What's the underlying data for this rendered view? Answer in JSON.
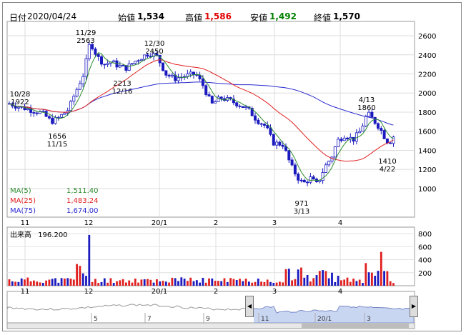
{
  "header": {
    "date_label": "日付",
    "date_value": "2020/04/24",
    "open_label": "始値",
    "open_value": "1,534",
    "high_label": "高値",
    "high_value": "1,586",
    "low_label": "安値",
    "low_value": "1,492",
    "close_label": "終値",
    "close_value": "1,570"
  },
  "colors": {
    "up": "#1a1abf",
    "down": "#1a1abf",
    "ma5": "#2e8b2e",
    "ma25": "#e02020",
    "ma75": "#2a2ad0",
    "high_value": "#e00000",
    "low_value": "#008000",
    "vol_up": "#e02020",
    "vol_down": "#1a1abf",
    "navigator_fill": "#c9d6f2"
  },
  "ma_legend": [
    {
      "label": "MA(5)",
      "value": "1,511.40",
      "color": "#2e8b2e"
    },
    {
      "label": "MA(25)",
      "value": "1,483.24",
      "color": "#e02020"
    },
    {
      "label": "MA(75)",
      "value": "1,674.00",
      "color": "#2a2ad0"
    }
  ],
  "volume_label": "出来高",
  "volume_value": "196.200",
  "x_ticks": [
    "11",
    "12",
    "20/1",
    "2",
    "3",
    "4"
  ],
  "nav_ticks": [
    "5",
    "7",
    "9",
    "11",
    "20/1",
    "3"
  ],
  "chart_data": {
    "type": "candlestick",
    "title": "",
    "ylim": [
      700,
      2750
    ],
    "y_ticks": [
      1000,
      1200,
      1400,
      1600,
      1800,
      2000,
      2200,
      2400,
      2600
    ],
    "annotations": [
      {
        "date": "10/28",
        "value": "1922"
      },
      {
        "date": "11/15",
        "value": "1656"
      },
      {
        "date": "11/29",
        "value": "2563"
      },
      {
        "date": "12/16",
        "value": "2213"
      },
      {
        "date": "12/30",
        "value": "2450"
      },
      {
        "date": "3/13",
        "value": "971"
      },
      {
        "date": "4/13",
        "value": "1860"
      },
      {
        "date": "4/22",
        "value": "1410"
      }
    ],
    "volume": {
      "y_ticks": [
        200,
        400,
        600,
        800
      ],
      "ylim": [
        0,
        900
      ]
    },
    "ma_final": {
      "MA(5)": 1511.4,
      "MA(25)": 1483.24,
      "MA(75)": 1674.0
    }
  }
}
